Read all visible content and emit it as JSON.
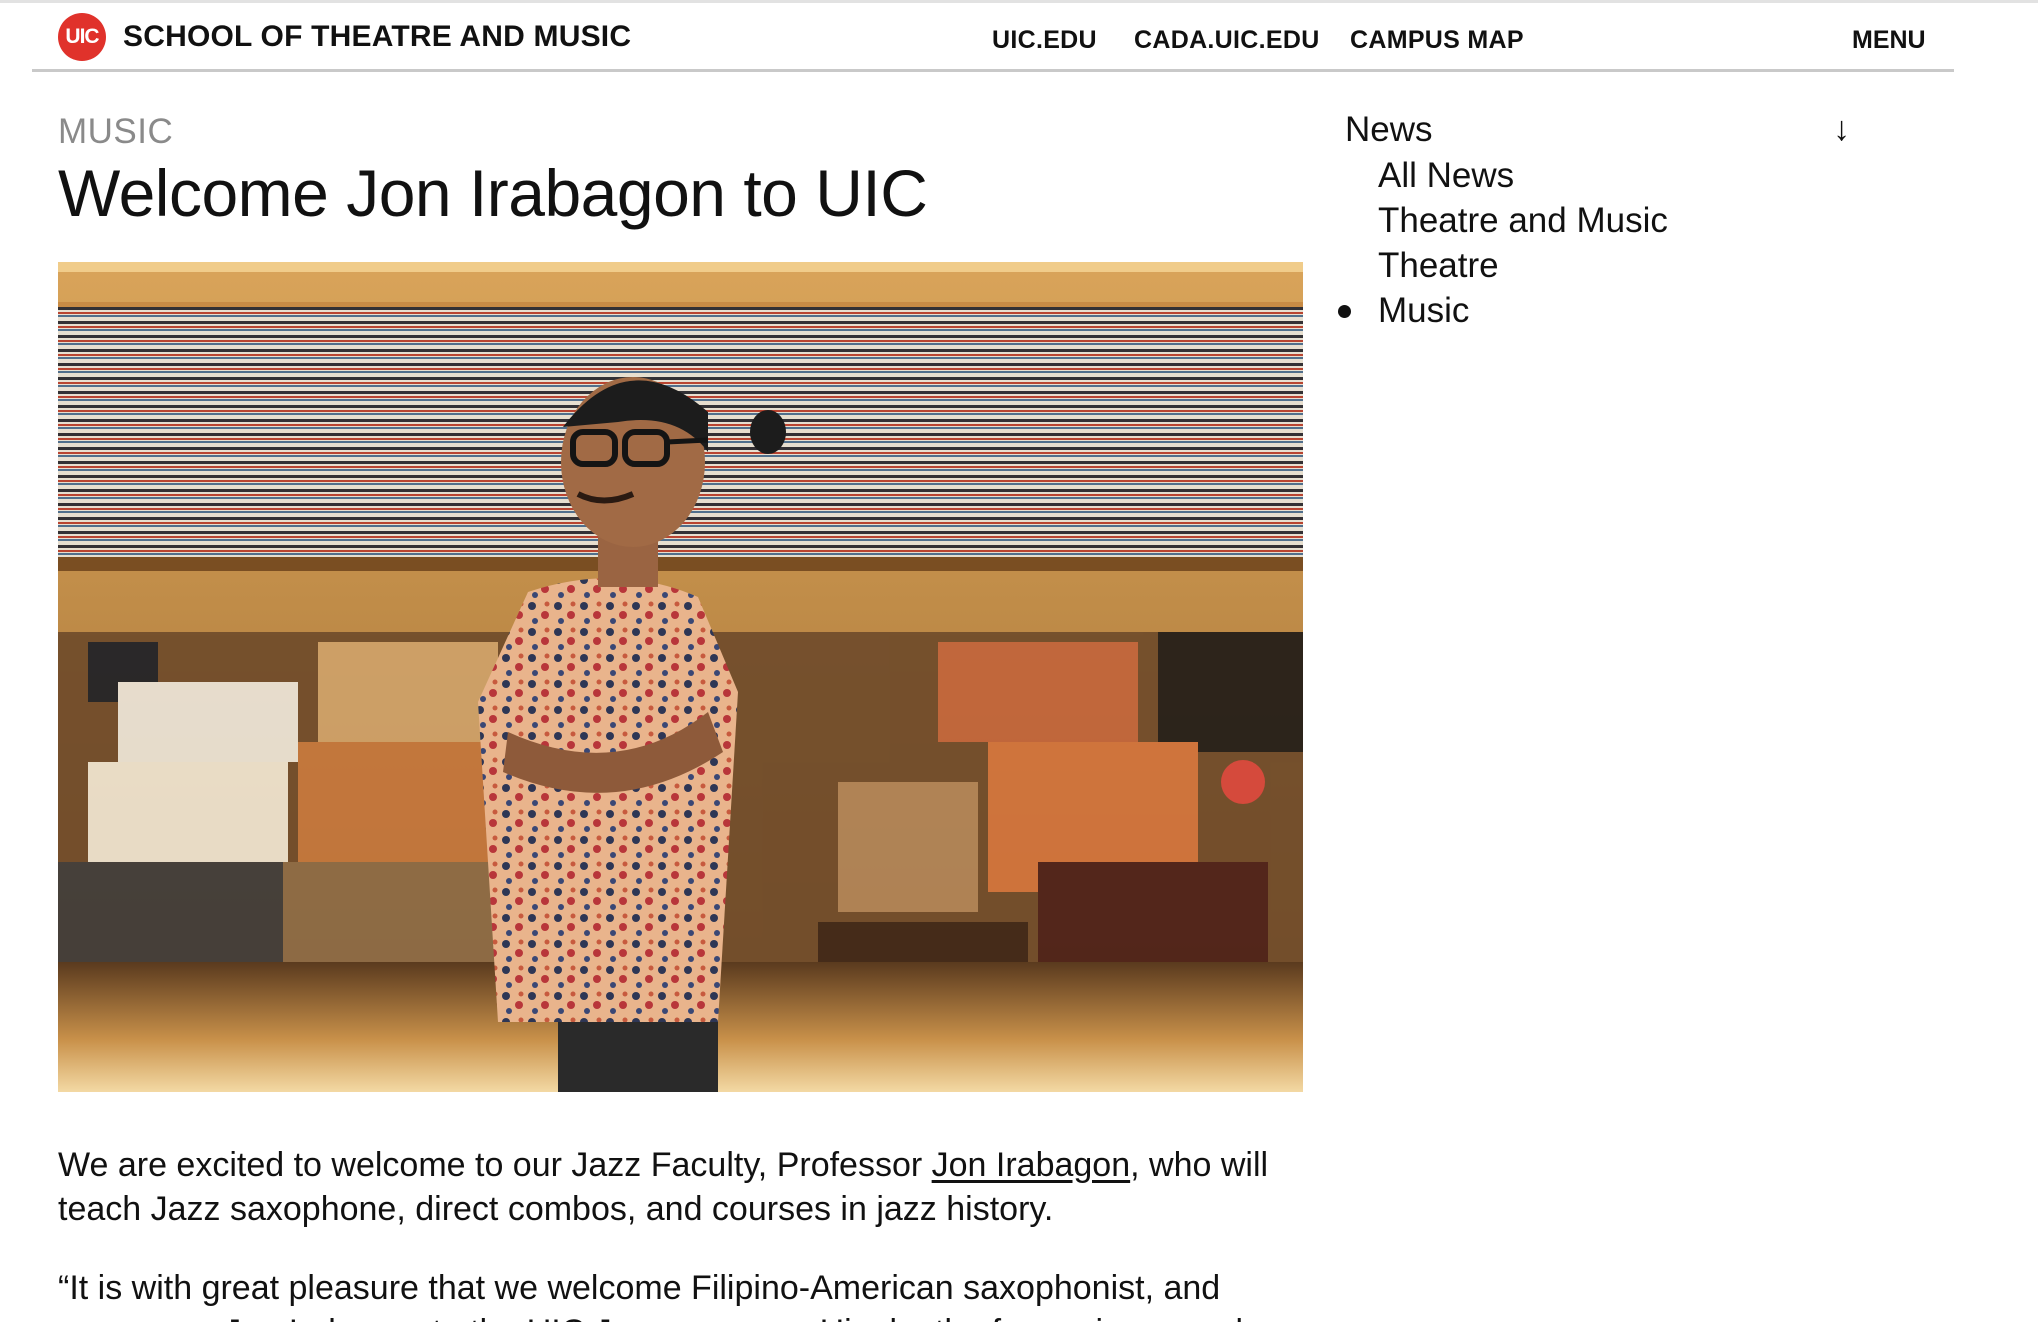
{
  "header": {
    "logo_text": "UIC",
    "site_title": "SCHOOL OF THEATRE AND MUSIC",
    "nav": [
      "UIC.EDU",
      "CADA.UIC.EDU",
      "CAMPUS MAP"
    ],
    "menu_label": "MENU",
    "logo_color": "#e0322b"
  },
  "article": {
    "category": "MUSIC",
    "title": "Welcome Jon Irabagon to UIC",
    "paragraph1_before": "We are excited to welcome to our Jazz Faculty, Professor ",
    "paragraph1_link": "Jon Irabagon",
    "paragraph1_after": ", who will teach Jazz saxophone, direct combos, and courses in jazz history.",
    "paragraph2": "“It is with great pleasure that we welcome Filipino-American saxophonist, and composer, Jon Irabagon to the UIC Jazz program. His depth of experience and"
  },
  "sidebar": {
    "heading": "News",
    "arrow_icon": "↓",
    "items": [
      "All News",
      "Theatre and Music",
      "Theatre",
      "Music"
    ],
    "active_index": 3
  }
}
